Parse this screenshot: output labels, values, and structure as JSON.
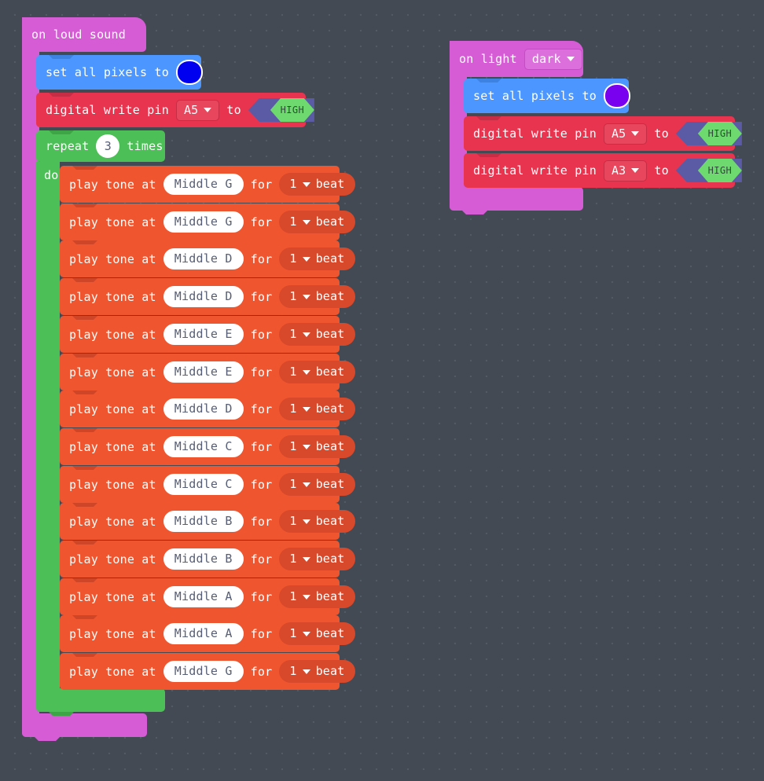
{
  "workspace": {
    "background_color": "#434a54",
    "grid_dot_color": "#525a65"
  },
  "scripts": [
    {
      "id": "loud-sound-script",
      "hat": {
        "label": "on loud sound",
        "color": "#d65cd6"
      },
      "blocks": [
        {
          "type": "set-all-pixels",
          "label": "set all pixels to",
          "color": "#4c97ff",
          "swatch_color": "#0000f0"
        },
        {
          "type": "digital-write-pin",
          "label_left": "digital write pin",
          "pin": "A5",
          "label_mid": "to",
          "value": "HIGH",
          "color": "#e8344e"
        },
        {
          "type": "repeat",
          "label_left": "repeat",
          "count": "3",
          "label_right": "times",
          "label_do": "do",
          "color": "#4cbf56",
          "body": [
            {
              "type": "play-tone",
              "label_left": "play tone at",
              "note": "Middle G",
              "label_for": "for",
              "beats": "1",
              "label_beat": "beat"
            },
            {
              "type": "play-tone",
              "label_left": "play tone at",
              "note": "Middle G",
              "label_for": "for",
              "beats": "1",
              "label_beat": "beat"
            },
            {
              "type": "play-tone",
              "label_left": "play tone at",
              "note": "Middle D",
              "label_for": "for",
              "beats": "1",
              "label_beat": "beat"
            },
            {
              "type": "play-tone",
              "label_left": "play tone at",
              "note": "Middle D",
              "label_for": "for",
              "beats": "1",
              "label_beat": "beat"
            },
            {
              "type": "play-tone",
              "label_left": "play tone at",
              "note": "Middle E",
              "label_for": "for",
              "beats": "1",
              "label_beat": "beat"
            },
            {
              "type": "play-tone",
              "label_left": "play tone at",
              "note": "Middle E",
              "label_for": "for",
              "beats": "1",
              "label_beat": "beat"
            },
            {
              "type": "play-tone",
              "label_left": "play tone at",
              "note": "Middle D",
              "label_for": "for",
              "beats": "1",
              "label_beat": "beat"
            },
            {
              "type": "play-tone",
              "label_left": "play tone at",
              "note": "Middle C",
              "label_for": "for",
              "beats": "1",
              "label_beat": "beat"
            },
            {
              "type": "play-tone",
              "label_left": "play tone at",
              "note": "Middle C",
              "label_for": "for",
              "beats": "1",
              "label_beat": "beat"
            },
            {
              "type": "play-tone",
              "label_left": "play tone at",
              "note": "Middle B",
              "label_for": "for",
              "beats": "1",
              "label_beat": "beat"
            },
            {
              "type": "play-tone",
              "label_left": "play tone at",
              "note": "Middle B",
              "label_for": "for",
              "beats": "1",
              "label_beat": "beat"
            },
            {
              "type": "play-tone",
              "label_left": "play tone at",
              "note": "Middle A",
              "label_for": "for",
              "beats": "1",
              "label_beat": "beat"
            },
            {
              "type": "play-tone",
              "label_left": "play tone at",
              "note": "Middle A",
              "label_for": "for",
              "beats": "1",
              "label_beat": "beat"
            },
            {
              "type": "play-tone",
              "label_left": "play tone at",
              "note": "Middle G",
              "label_for": "for",
              "beats": "1",
              "label_beat": "beat"
            }
          ]
        }
      ]
    },
    {
      "id": "on-light-script",
      "hat": {
        "label": "on light",
        "condition": "dark",
        "color": "#d65cd6"
      },
      "blocks": [
        {
          "type": "set-all-pixels",
          "label": "set all pixels to",
          "color": "#4c97ff",
          "swatch_color": "#7a00f0"
        },
        {
          "type": "digital-write-pin",
          "label_left": "digital write pin",
          "pin": "A5",
          "label_mid": "to",
          "value": "HIGH",
          "color": "#e8344e"
        },
        {
          "type": "digital-write-pin",
          "label_left": "digital write pin",
          "pin": "A3",
          "label_mid": "to",
          "value": "HIGH",
          "color": "#e8344e"
        }
      ]
    }
  ]
}
